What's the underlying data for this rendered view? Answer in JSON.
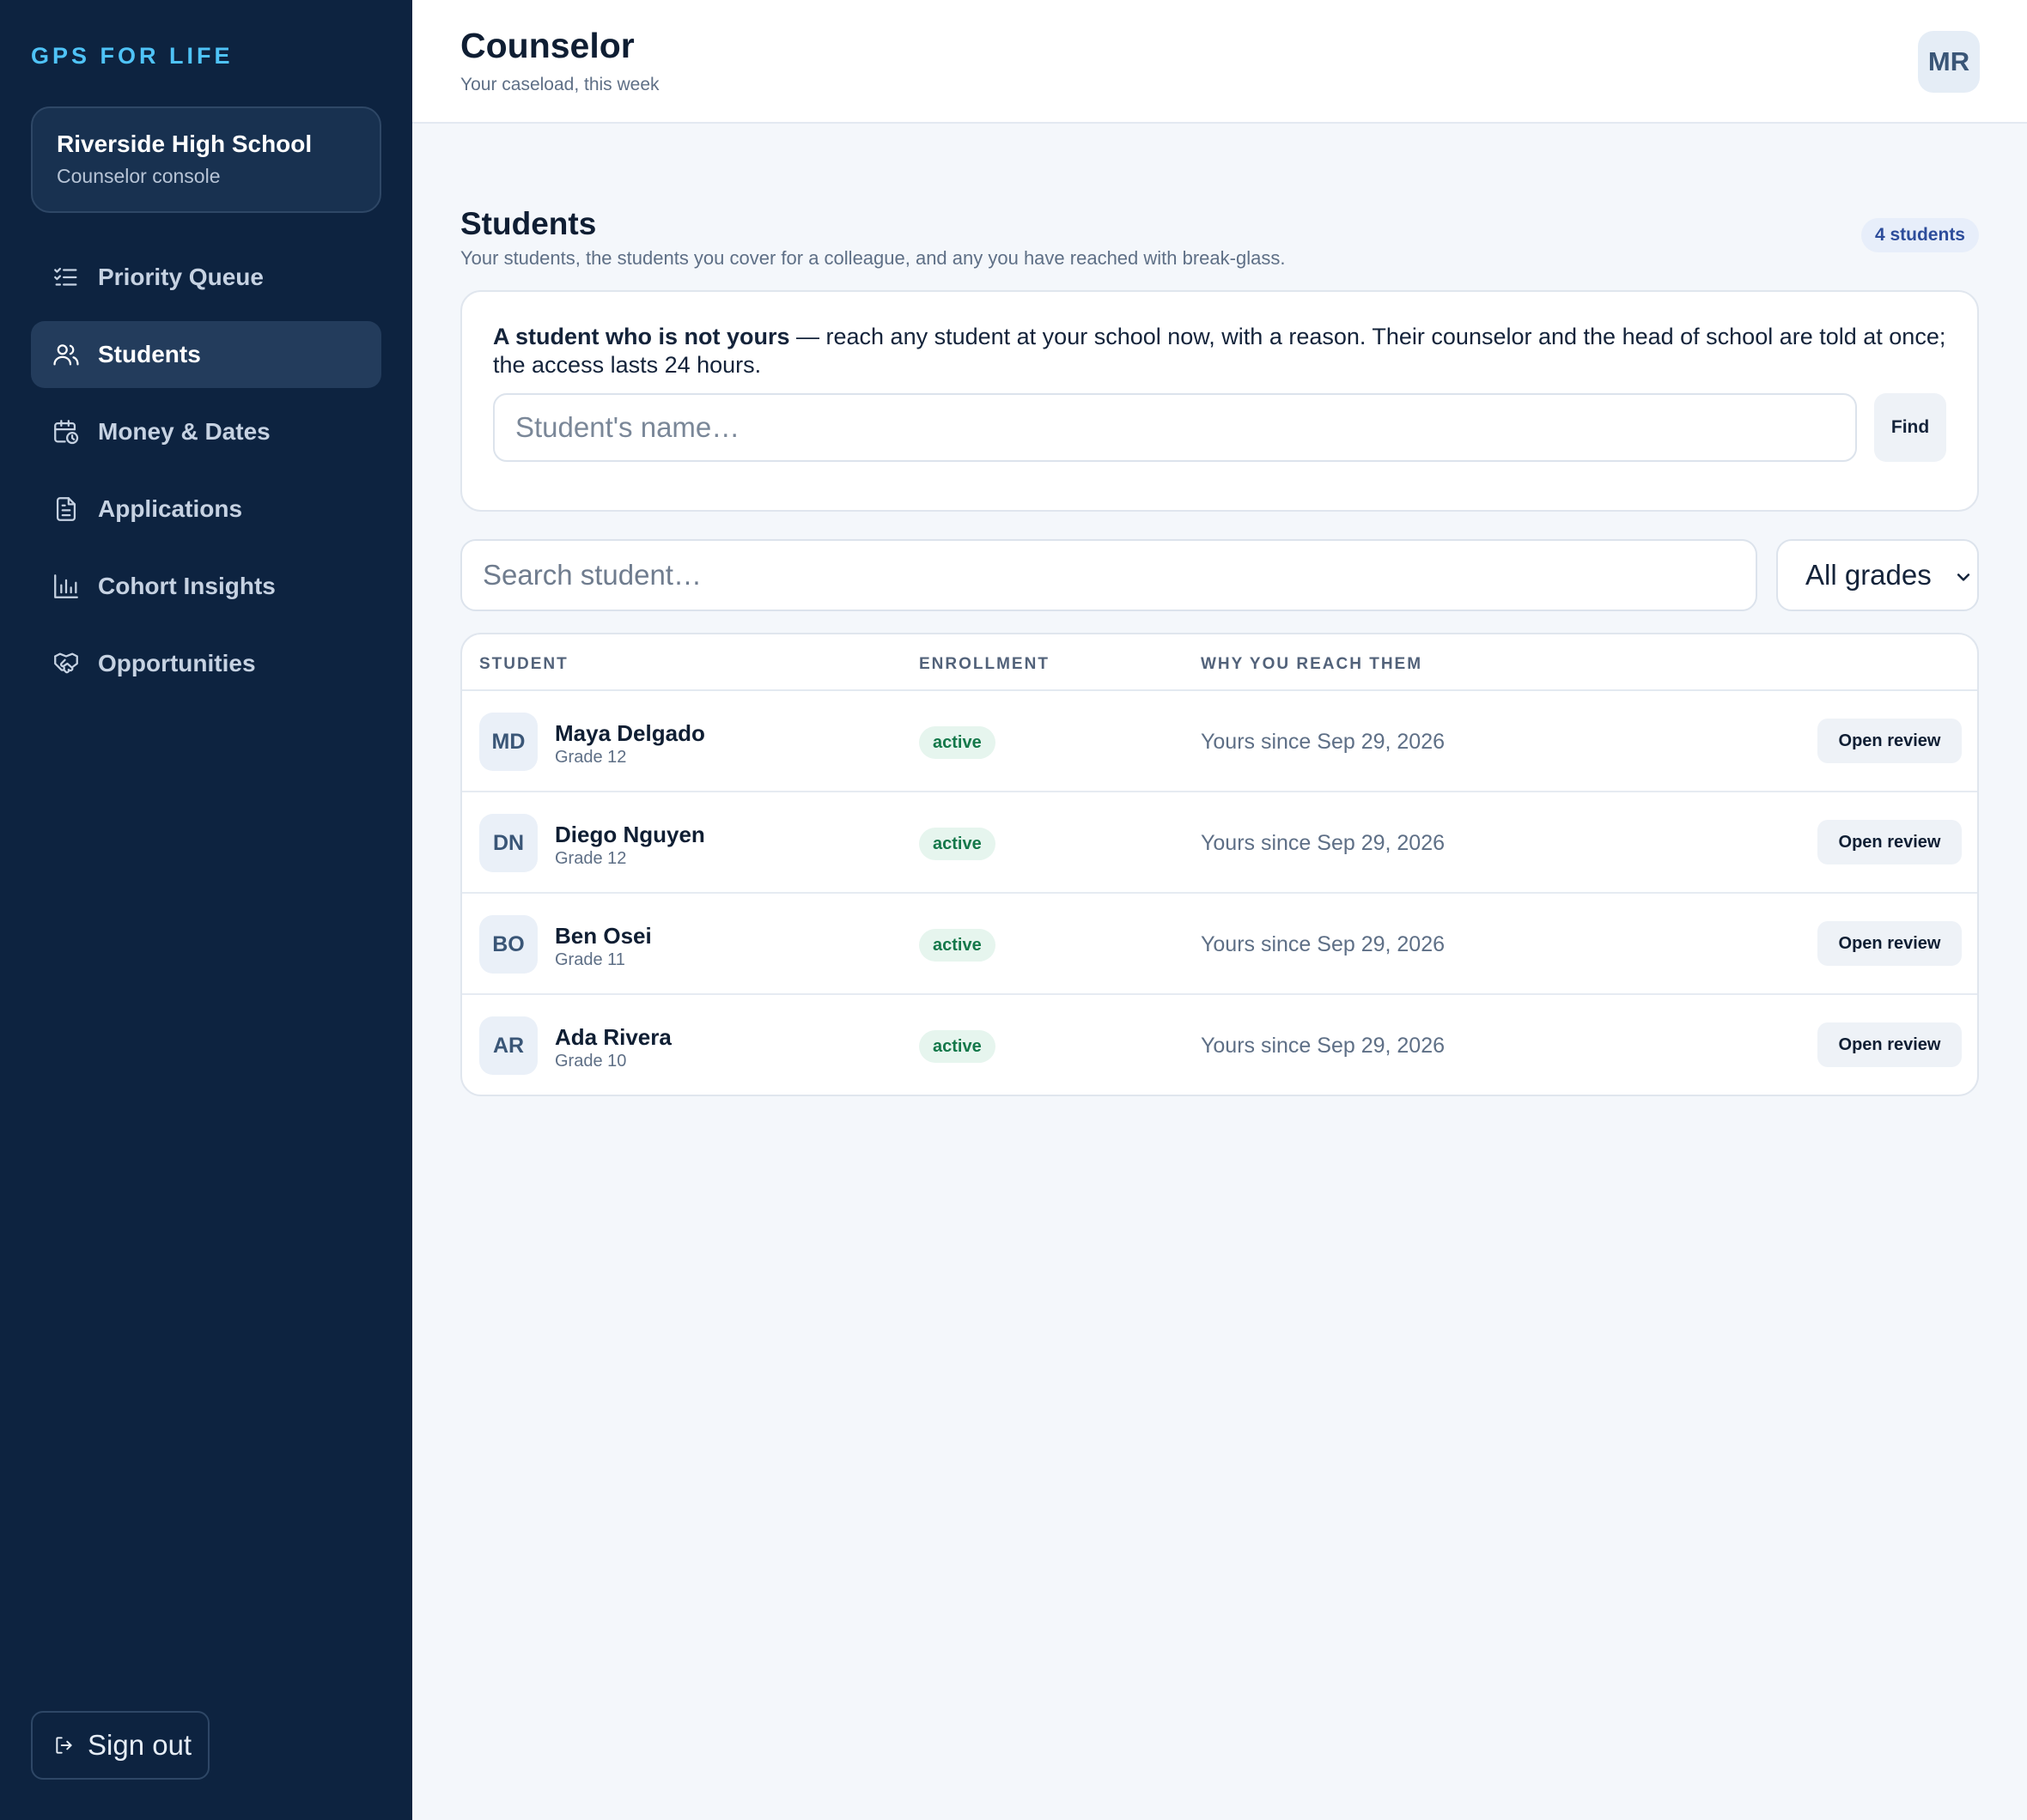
{
  "app": {
    "brand": "GPS FOR LIFE"
  },
  "school": {
    "name": "Riverside High School",
    "role": "Counselor console"
  },
  "nav": [
    {
      "label": "Priority Queue",
      "icon": "checklist-icon",
      "active": false
    },
    {
      "label": "Students",
      "icon": "users-icon",
      "active": true
    },
    {
      "label": "Money & Dates",
      "icon": "calendar-clock-icon",
      "active": false
    },
    {
      "label": "Applications",
      "icon": "document-icon",
      "active": false
    },
    {
      "label": "Cohort Insights",
      "icon": "bar-chart-icon",
      "active": false
    },
    {
      "label": "Opportunities",
      "icon": "handshake-icon",
      "active": false
    }
  ],
  "signout": {
    "label": "Sign out",
    "icon": "sign-out-icon"
  },
  "header": {
    "title": "Counselor",
    "subtitle": "Your caseload, this week",
    "user_initials": "MR"
  },
  "section": {
    "title": "Students",
    "subtitle": "Your students, the students you cover for a colleague, and any you have reached with break-glass.",
    "count": "4 students"
  },
  "breakglass": {
    "lead": "A student who is not yours",
    "text": " — reach any student at your school now, with a reason. Their counselor and the head of school are told at once; the access lasts 24 hours.",
    "placeholder": "Student's name…",
    "button": "Find"
  },
  "search": {
    "placeholder": "Search student…"
  },
  "grade_filter": {
    "selected": "All grades"
  },
  "table": {
    "columns": [
      "STUDENT",
      "ENROLLMENT",
      "WHY YOU REACH THEM"
    ],
    "action_label": "Open review",
    "rows": [
      {
        "initials": "MD",
        "name": "Maya Delgado",
        "grade": "Grade 12",
        "status": "active",
        "reason": "Yours since Sep 29, 2026"
      },
      {
        "initials": "DN",
        "name": "Diego Nguyen",
        "grade": "Grade 12",
        "status": "active",
        "reason": "Yours since Sep 29, 2026"
      },
      {
        "initials": "BO",
        "name": "Ben Osei",
        "grade": "Grade 11",
        "status": "active",
        "reason": "Yours since Sep 29, 2026"
      },
      {
        "initials": "AR",
        "name": "Ada Rivera",
        "grade": "Grade 10",
        "status": "active",
        "reason": "Yours since Sep 29, 2026"
      }
    ]
  },
  "colors": {
    "sidebar_bg": "#0d2340",
    "brand_accent": "#4fc3f7",
    "status_active": "#14784a",
    "count_badge": "#2d4d9b"
  }
}
